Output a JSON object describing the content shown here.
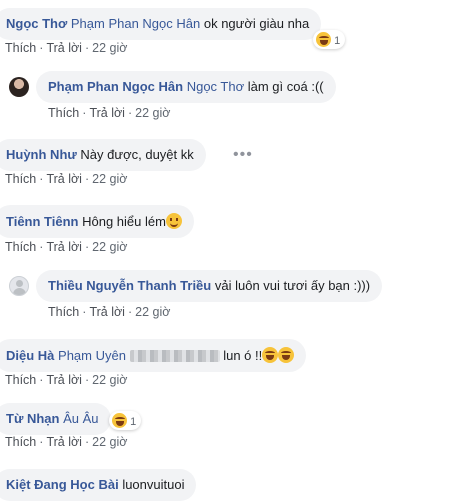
{
  "actions": {
    "like": "Thích",
    "reply": "Trả lời",
    "time": "22 giờ"
  },
  "comments": [
    {
      "author": "Ngọc Thơ",
      "mention": "Phạm Phan Ngọc Hân",
      "text": "ok người giàu nha",
      "reaction_count": "1",
      "reaction_icon": "laughing-emoji"
    },
    {
      "author": "Phạm Phan Ngọc Hân",
      "mention": "Ngọc Thơ",
      "text": "làm gì coá :(("
    },
    {
      "author": "Huỳnh Như",
      "text": "Này được, duyệt kk"
    },
    {
      "author": "Tiênn Tiênn",
      "text": "Hông hiểu lém",
      "emoji": "grinning-emoji"
    },
    {
      "author": "Thiều Nguyễn Thanh Triều",
      "text": "vải luôn vui tươi ấy bạn :)))"
    },
    {
      "author": "Diệu Hà",
      "mention": "Phạm Uyên",
      "text": "lun ó !!"
    },
    {
      "author": "Từ Nhạn",
      "text": "Âu Âu",
      "reaction_count": "1"
    },
    {
      "author": "Kiệt Đang Học Bài",
      "text": "luonvuituoi"
    }
  ]
}
